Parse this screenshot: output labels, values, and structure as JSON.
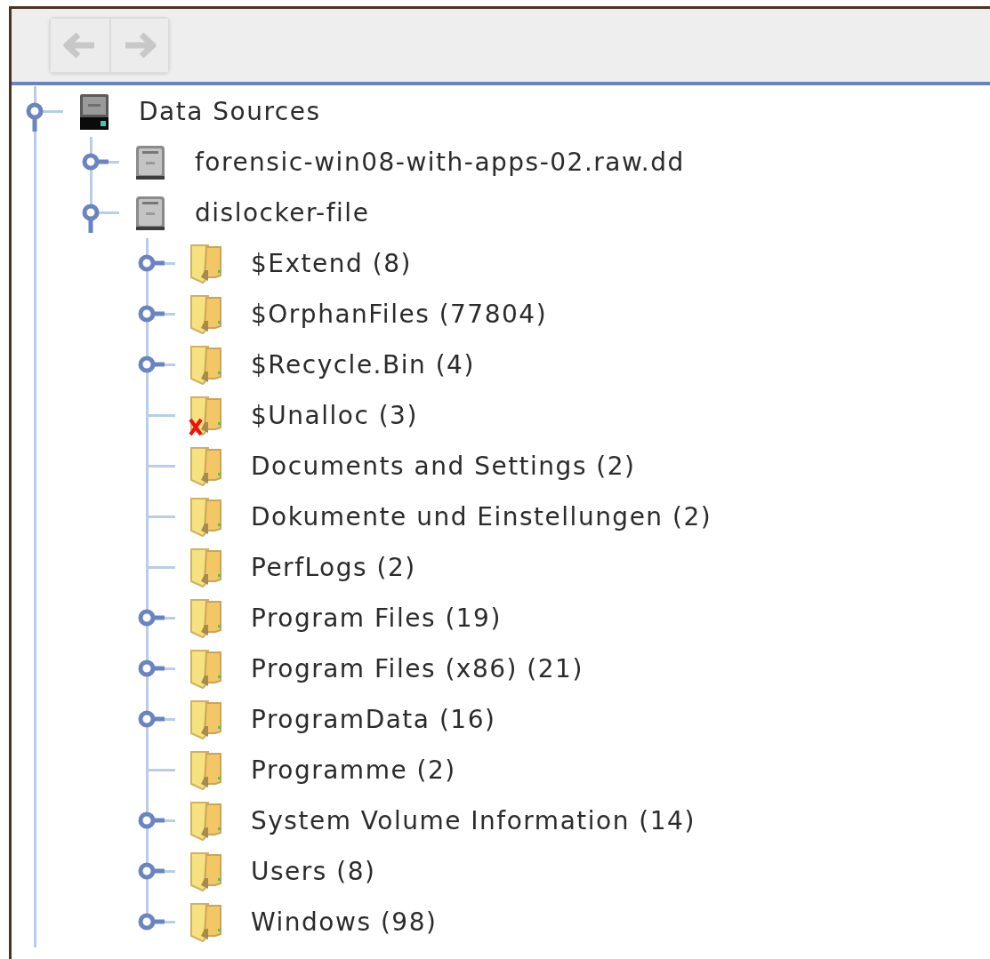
{
  "toolbar": {
    "back_button": {
      "disabled": true
    },
    "forward_button": {
      "disabled": true
    }
  },
  "tree": [
    {
      "label": "Data Sources",
      "kind": "source-group",
      "expanded": true,
      "children": [
        {
          "label": "forensic-win08-with-apps-02.raw.dd",
          "kind": "disk",
          "expanded": false
        },
        {
          "label": "dislocker-file",
          "kind": "disk",
          "expanded": true,
          "children": [
            {
              "label": "$Extend (8)",
              "kind": "folder",
              "expanded": false,
              "marked": false
            },
            {
              "label": "$OrphanFiles (77804)",
              "kind": "folder",
              "expanded": false,
              "marked": false
            },
            {
              "label": "$Recycle.Bin (4)",
              "kind": "folder",
              "expanded": false,
              "marked": false
            },
            {
              "label": "$Unalloc (3)",
              "kind": "folder",
              "marked": true
            },
            {
              "label": "Documents and Settings (2)",
              "kind": "folder",
              "marked": false
            },
            {
              "label": "Dokumente und Einstellungen (2)",
              "kind": "folder",
              "marked": false
            },
            {
              "label": "PerfLogs (2)",
              "kind": "folder",
              "marked": false
            },
            {
              "label": "Program Files (19)",
              "kind": "folder",
              "expanded": false,
              "marked": false
            },
            {
              "label": "Program Files (x86) (21)",
              "kind": "folder",
              "expanded": false,
              "marked": false
            },
            {
              "label": "ProgramData (16)",
              "kind": "folder",
              "expanded": false,
              "marked": false
            },
            {
              "label": "Programme (2)",
              "kind": "folder",
              "marked": false
            },
            {
              "label": "System Volume Information (14)",
              "kind": "folder",
              "expanded": false,
              "marked": false
            },
            {
              "label": "Users (8)",
              "kind": "folder",
              "expanded": false,
              "marked": false
            },
            {
              "label": "Windows (98)",
              "kind": "folder",
              "expanded": false,
              "marked": false
            }
          ]
        }
      ]
    }
  ]
}
